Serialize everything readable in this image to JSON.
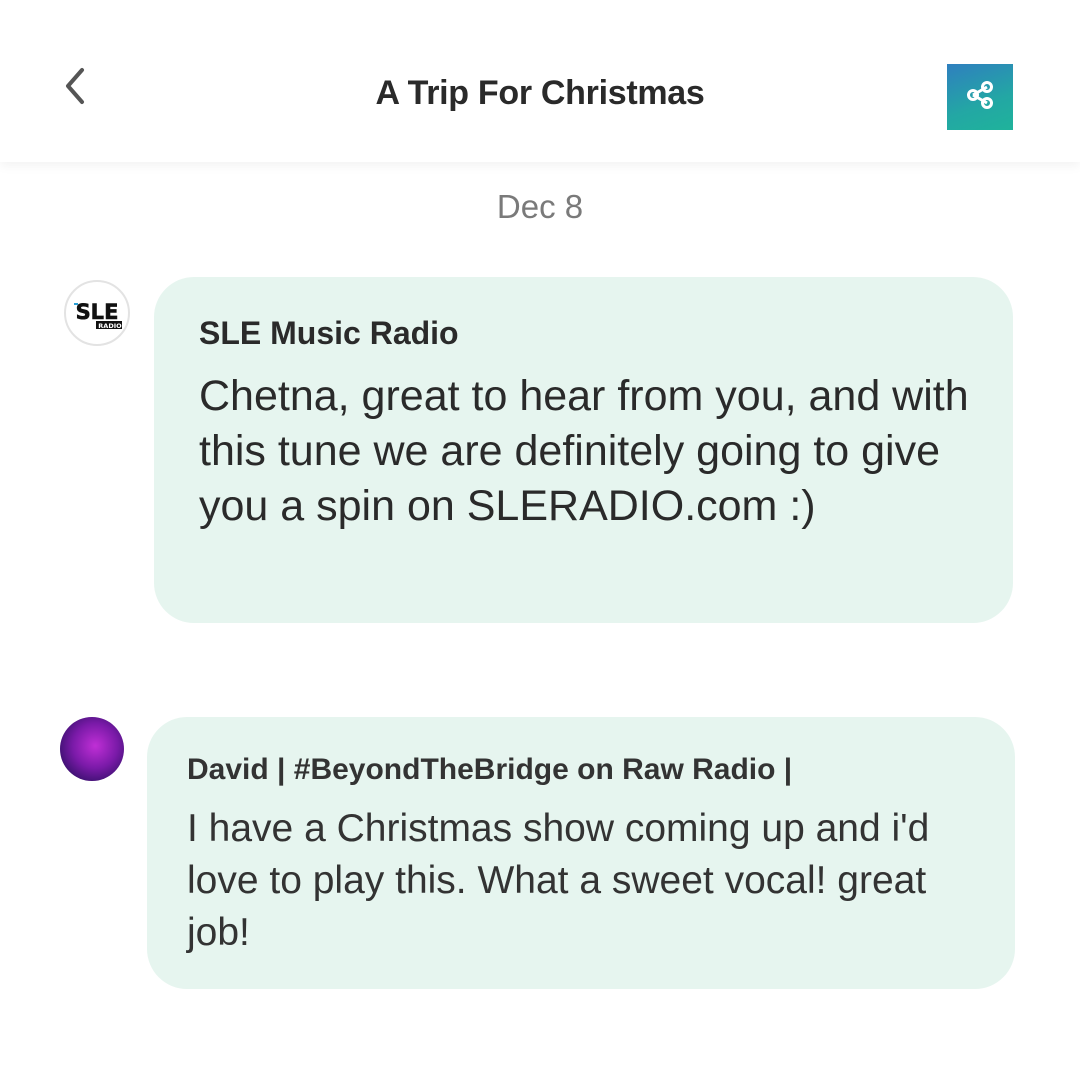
{
  "header": {
    "title": "A Trip For Christmas",
    "back_icon": "chevron-left-icon",
    "share_icon": "share-icon",
    "share_gradient": [
      "#2f7fbf",
      "#1fb39b"
    ]
  },
  "date": "Dec 8",
  "comments": [
    {
      "author": "SLE Music Radio",
      "message": "Chetna, great to hear from you, and with this tune we are definitely going to give you a spin on SLERADIO.com :)",
      "avatar_logo": "SLE RADIO"
    },
    {
      "author": "David | #BeyondTheBridge on Raw Radio |",
      "message": "I have a Christmas show coming up and i'd love to play this. What a sweet vocal! great job!"
    }
  ],
  "colors": {
    "bubble_background": "#e6f5ef",
    "text": "#2a2a2a",
    "date_text": "#7a7a7a"
  }
}
